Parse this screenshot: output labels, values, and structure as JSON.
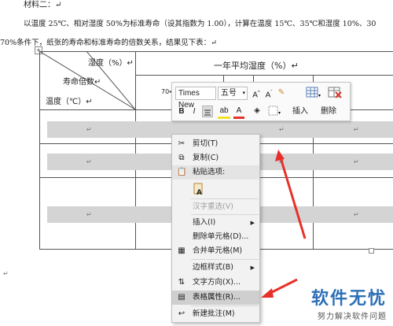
{
  "document": {
    "material_label": "材料二：↵",
    "paragraph_line1": "以温度 25℃、相对湿度 50%为标准寿命（设其指数为 1.00），计算在温度 15℃、35℃和湿度 10%、30",
    "paragraph_line2": "70%条件下，纸张的寿命和标准寿命的倍数关系，结果见下表：↵",
    "bottom_para_mark": "↵"
  },
  "table": {
    "header_humidity": "湿度（%）↵",
    "header_life_multiple": "寿命倍数↵",
    "header_temperature": "温度（℃）↵",
    "header_annual_avg": "一年平均湿度（%）↵",
    "cell_70": "70↵",
    "cell_mark": "↵"
  },
  "mini_toolbar": {
    "font_name": "Times New",
    "font_size": "五号",
    "bold": "B",
    "italic": "I",
    "insert_label": "插入",
    "delete_label": "删除"
  },
  "context_menu": {
    "items": [
      {
        "label": "剪切(T)",
        "icon": "scissors-icon",
        "enabled": true
      },
      {
        "label": "复制(C)",
        "icon": "copy-icon",
        "enabled": true
      },
      {
        "label": "粘贴选项:",
        "icon": "paste-icon",
        "enabled": true
      },
      {
        "label": "汉字重选(V)",
        "enabled": false
      },
      {
        "label": "插入(I)",
        "enabled": true,
        "submenu": true
      },
      {
        "label": "删除单元格(D)...",
        "enabled": true
      },
      {
        "label": "合并单元格(M)",
        "icon": "merge-cells-icon",
        "enabled": true
      },
      {
        "label": "边框样式(B)",
        "enabled": true,
        "submenu": true
      },
      {
        "label": "文字方向(X)...",
        "icon": "text-direction-icon",
        "enabled": true
      },
      {
        "label": "表格属性(R)...",
        "icon": "table-properties-icon",
        "enabled": true,
        "highlighted": true
      },
      {
        "label": "新建批注(M)",
        "icon": "new-comment-icon",
        "enabled": true
      }
    ]
  },
  "watermark": {
    "brand": "软件无忧",
    "subtitle": "努力解决软件问题"
  },
  "colors": {
    "arrow": "#e8302a",
    "watermark_blue": "#2d6fb7",
    "row_shade": "#d4d4d4"
  }
}
